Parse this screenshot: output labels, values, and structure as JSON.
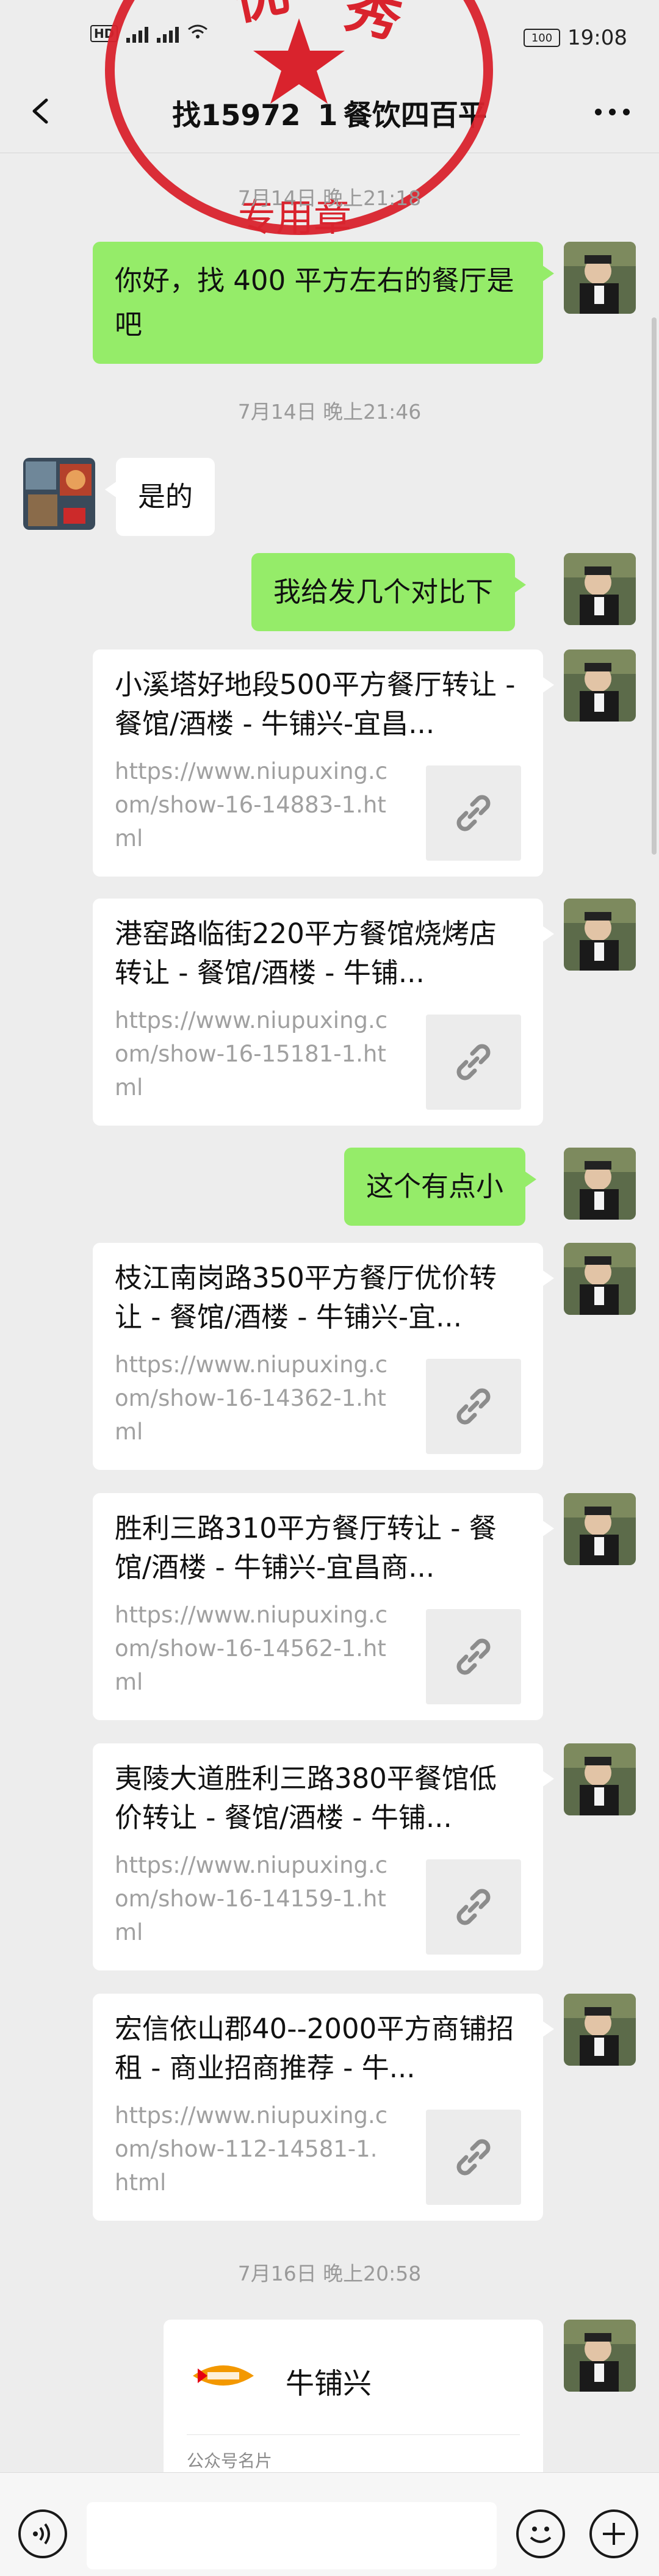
{
  "status_bar": {
    "left_icons": [
      "HD",
      "4G",
      "3G",
      "wifi"
    ],
    "battery": "100",
    "time": "19:08"
  },
  "header": {
    "title": "找15972   1 餐饮四百平",
    "back_icon": "chevron-left-icon",
    "more_icon": "more-dots-icon"
  },
  "seal": {
    "top_text": "优 秀",
    "bottom_text": "专用章",
    "color": "#d9232d"
  },
  "messages": {
    "ts1": "7月14日 晚上21:18",
    "msg1": "你好，找 400 平方左右的餐厅是吧",
    "ts2": "7月14日 晚上21:46",
    "msg2": "是的",
    "msg3": "我给发几个对比下",
    "msg4": "这个有点小",
    "ts3": "7月16日 晚上20:58"
  },
  "links": [
    {
      "title": "小溪塔好地段500平方餐厅转让 - 餐馆/酒楼 - 牛铺兴-宜昌...",
      "url": "https://www.niupuxing.com/show-16-14883-1.html"
    },
    {
      "title": "港窑路临街220平方餐馆烧烤店转让 - 餐馆/酒楼 - 牛铺...",
      "url": "https://www.niupuxing.com/show-16-15181-1.html"
    },
    {
      "title": "枝江南岗路350平方餐厅优价转让 - 餐馆/酒楼 - 牛铺兴-宜...",
      "url": "https://www.niupuxing.com/show-16-14362-1.html"
    },
    {
      "title": "胜利三路310平方餐厅转让 - 餐馆/酒楼 - 牛铺兴-宜昌商...",
      "url": "https://www.niupuxing.com/show-16-14562-1.html"
    },
    {
      "title": "夷陵大道胜利三路380平餐馆低价转让 - 餐馆/酒楼 - 牛铺...",
      "url": "https://www.niupuxing.com/show-16-14159-1.html"
    },
    {
      "title": "宏信依山郡40--2000平方商铺招租 - 商业招商推荐 - 牛...",
      "url": "https://www.niupuxing.com/show-112-14581-1.html"
    }
  ],
  "business_card": {
    "name": "牛铺兴",
    "label": "公众号名片"
  },
  "input_bar": {
    "voice_icon": "voice-icon",
    "emoji_icon": "emoji-icon",
    "plus_icon": "plus-icon",
    "input_value": ""
  },
  "colors": {
    "bubble_me": "#95ec69",
    "bubble_other": "#ffffff",
    "background": "#ededed"
  }
}
